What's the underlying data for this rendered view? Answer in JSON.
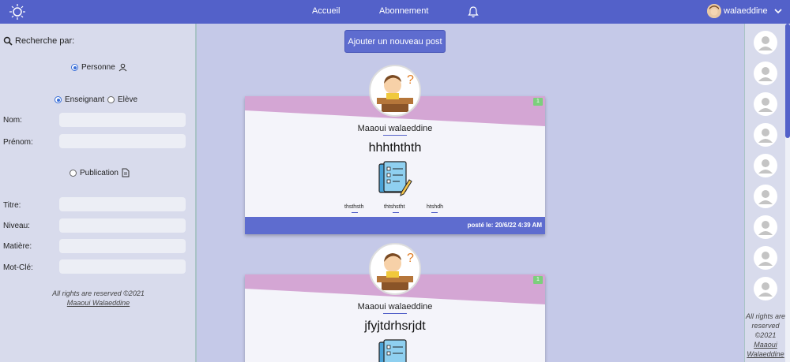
{
  "nav": {
    "links": [
      "Accueil",
      "Abonnement"
    ],
    "user_name": "walaeddine"
  },
  "search": {
    "title": "Recherche par:",
    "person_option": "Personne",
    "teacher_option": "Enseignant",
    "student_option": "Elève",
    "person_fields": [
      {
        "label": "Nom:",
        "value": ""
      },
      {
        "label": "Prénom:",
        "value": ""
      }
    ],
    "publication_option": "Publication",
    "publication_fields": [
      {
        "label": "Titre:",
        "value": ""
      },
      {
        "label": "Niveau:",
        "value": ""
      },
      {
        "label": "Matière:",
        "value": ""
      },
      {
        "label": "Mot-Clé:",
        "value": ""
      }
    ],
    "footer_line1": "All rights are reserved ©2021",
    "footer_line2": "Maaoui Walaeddine"
  },
  "main": {
    "add_post_label": "Ajouter un nouveau post",
    "posts": [
      {
        "badge": "1",
        "author": "Maaoui walaeddine",
        "title": "hhhththth",
        "tags": [
          "thsthsth",
          "thtshstht",
          "htshdh"
        ],
        "posted": "posté le: 20/6/22 4:39 AM"
      },
      {
        "badge": "1",
        "author": "Maaoui walaeddine",
        "title": "jfyjtdrhsrjdt",
        "tags": [],
        "posted": ""
      }
    ]
  },
  "rightbar": {
    "avatar_count": 9,
    "footer_line1": "All rights are reserved ©2021",
    "footer_line2": "Maaoui Walaeddine"
  },
  "colors": {
    "nav": "#5361c9",
    "accent": "#5e6ccf",
    "post_band": "#d4a6d4",
    "badge": "#7ccf7c",
    "background": "#c5c9e8"
  },
  "icons": [
    "sun-logo-icon",
    "bell-icon",
    "chevron-down-icon",
    "search-icon",
    "user-icon",
    "document-icon",
    "checklist-icon",
    "default-avatar-icon"
  ]
}
